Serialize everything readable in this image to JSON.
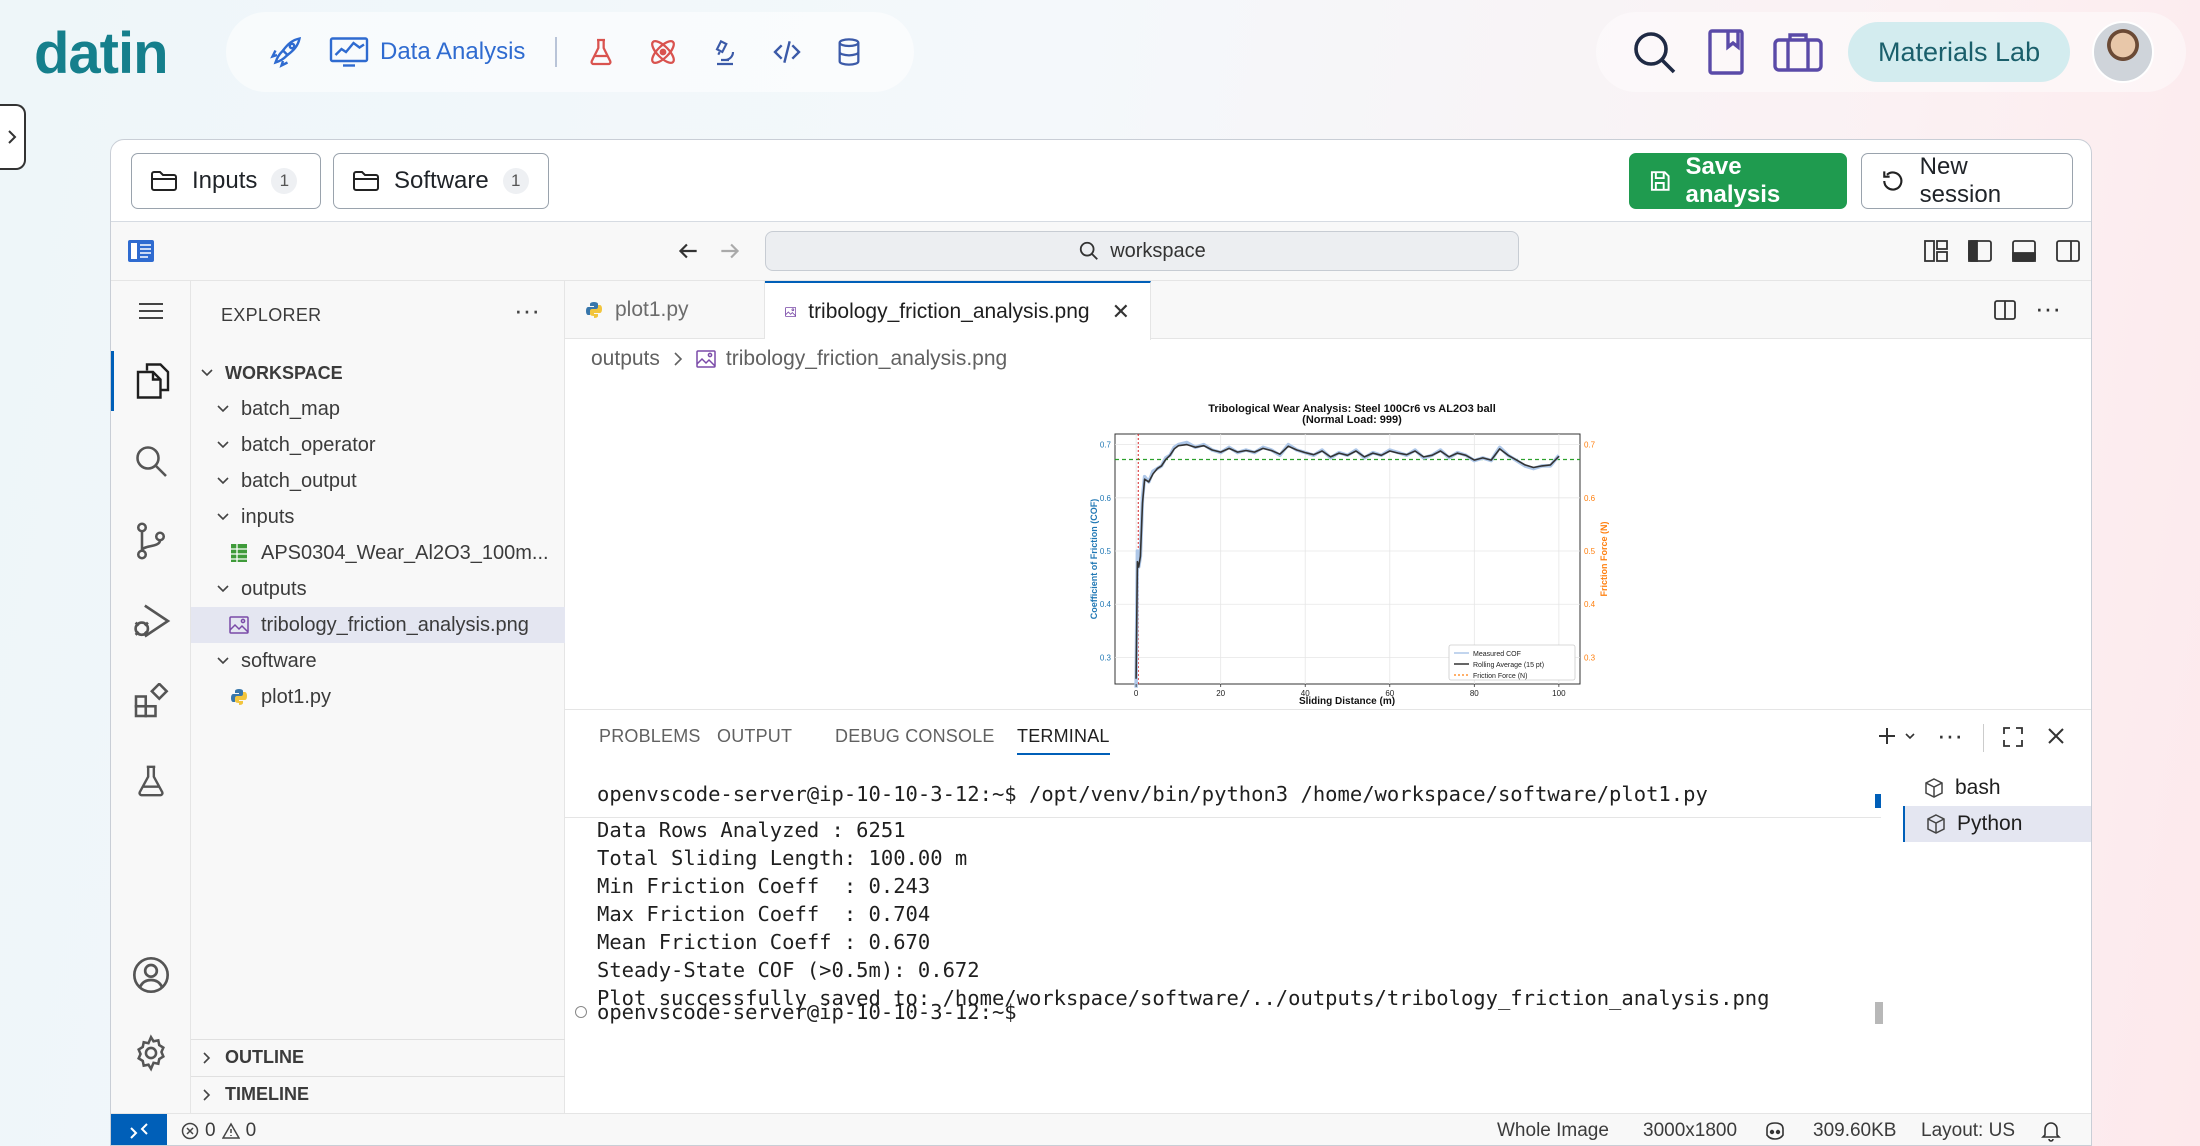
{
  "app": {
    "logo": "datin",
    "nav_active_label": "Data Analysis",
    "lab_label": "Materials Lab"
  },
  "toolbar": {
    "inputs_label": "Inputs",
    "inputs_count": "1",
    "software_label": "Software",
    "software_count": "1",
    "save_label": "Save analysis",
    "new_session_label": "New session"
  },
  "search": {
    "label": "workspace"
  },
  "explorer": {
    "title": "EXPLORER",
    "root": "WORKSPACE",
    "items": [
      {
        "label": "batch_map"
      },
      {
        "label": "batch_operator"
      },
      {
        "label": "batch_output"
      },
      {
        "label": "inputs"
      },
      {
        "label": "APS0304_Wear_Al2O3_100m..."
      },
      {
        "label": "outputs"
      },
      {
        "label": "tribology_friction_analysis.png"
      },
      {
        "label": "software"
      },
      {
        "label": "plot1.py"
      }
    ],
    "outline": "OUTLINE",
    "timeline": "TIMELINE"
  },
  "tabs": [
    {
      "label": "plot1.py"
    },
    {
      "label": "tribology_friction_analysis.png"
    }
  ],
  "breadcrumb": {
    "folder": "outputs",
    "file": "tribology_friction_analysis.png"
  },
  "chart_data": {
    "type": "line",
    "title": "Tribological Wear Analysis: Steel 100Cr6 vs AL2O3 ball",
    "subtitle": "(Normal Load: 999)",
    "xlabel": "Sliding Distance (m)",
    "ylabel": "Coefficient of Friction (COF)",
    "y2label": "Friction Force (N)",
    "xlim": [
      -5,
      105
    ],
    "ylim": [
      0.25,
      0.72
    ],
    "x_ticks": [
      "0",
      "20",
      "40",
      "60",
      "80",
      "100"
    ],
    "y_ticks": [
      "0.3",
      "0.4",
      "0.5",
      "0.6",
      "0.7"
    ],
    "y2_ticks": [
      "0.3",
      "0.4",
      "0.5",
      "0.6",
      "0.7"
    ],
    "grid": true,
    "legend_position": "bottom-right",
    "steady_state_cof": 0.672,
    "steady_state_color": "#2ca02c",
    "run_in_marker_x": 0.5,
    "run_in_color": "#d62728",
    "series": [
      {
        "name": "Measured COF",
        "color": "#aec7e8",
        "x": [
          0,
          0.3,
          0.6,
          1,
          1.5,
          2,
          3,
          4,
          5,
          6,
          7,
          8,
          9,
          10,
          12,
          14,
          16,
          18,
          20,
          22,
          24,
          26,
          28,
          30,
          32,
          34,
          36,
          38,
          40,
          42,
          44,
          46,
          48,
          50,
          52,
          54,
          56,
          58,
          60,
          62,
          64,
          66,
          68,
          70,
          72,
          74,
          76,
          78,
          80,
          82,
          84,
          86,
          88,
          90,
          92,
          94,
          96,
          98,
          100
        ],
        "y": [
          0.243,
          0.5,
          0.47,
          0.49,
          0.6,
          0.64,
          0.63,
          0.65,
          0.655,
          0.66,
          0.675,
          0.68,
          0.695,
          0.7,
          0.704,
          0.695,
          0.7,
          0.69,
          0.685,
          0.695,
          0.685,
          0.69,
          0.685,
          0.695,
          0.69,
          0.68,
          0.7,
          0.69,
          0.685,
          0.68,
          0.69,
          0.675,
          0.685,
          0.68,
          0.69,
          0.675,
          0.685,
          0.68,
          0.69,
          0.685,
          0.68,
          0.69,
          0.675,
          0.68,
          0.69,
          0.675,
          0.685,
          0.68,
          0.67,
          0.675,
          0.67,
          0.695,
          0.68,
          0.67,
          0.66,
          0.655,
          0.66,
          0.66,
          0.68
        ]
      },
      {
        "name": "Rolling Average (15 pt)",
        "color": "#333333",
        "x": [
          0,
          0.3,
          0.6,
          1,
          1.5,
          2,
          3,
          4,
          5,
          6,
          7,
          8,
          9,
          10,
          12,
          14,
          16,
          18,
          20,
          22,
          24,
          26,
          28,
          30,
          32,
          34,
          36,
          38,
          40,
          42,
          44,
          46,
          48,
          50,
          52,
          54,
          56,
          58,
          60,
          62,
          64,
          66,
          68,
          70,
          72,
          74,
          76,
          78,
          80,
          82,
          84,
          86,
          88,
          90,
          92,
          94,
          96,
          98,
          100
        ],
        "y": [
          0.26,
          0.48,
          0.47,
          0.49,
          0.59,
          0.635,
          0.63,
          0.645,
          0.655,
          0.66,
          0.672,
          0.68,
          0.692,
          0.698,
          0.7,
          0.695,
          0.698,
          0.69,
          0.686,
          0.693,
          0.686,
          0.689,
          0.686,
          0.693,
          0.689,
          0.682,
          0.697,
          0.69,
          0.685,
          0.681,
          0.688,
          0.677,
          0.684,
          0.68,
          0.688,
          0.677,
          0.684,
          0.68,
          0.688,
          0.684,
          0.681,
          0.688,
          0.677,
          0.68,
          0.688,
          0.677,
          0.684,
          0.68,
          0.671,
          0.675,
          0.671,
          0.692,
          0.68,
          0.671,
          0.662,
          0.657,
          0.66,
          0.662,
          0.678
        ]
      },
      {
        "name": "Friction Force (N)",
        "color": "#ff7f0e"
      }
    ]
  },
  "panel": {
    "tabs": [
      "PROBLEMS",
      "OUTPUT",
      "DEBUG CONSOLE",
      "TERMINAL"
    ],
    "terminal_lines": [
      "openvscode-server@ip-10-10-3-12:~$ /opt/venv/bin/python3 /home/workspace/software/plot1.py",
      "Data Rows Analyzed : 6251",
      "Total Sliding Length: 100.00 m",
      "Min Friction Coeff  : 0.243",
      "Max Friction Coeff  : 0.704",
      "Mean Friction Coeff : 0.670",
      "Steady-State COF (>0.5m): 0.672",
      "Plot successfully saved to: /home/workspace/software/../outputs/tribology_friction_analysis.png",
      "openvscode-server@ip-10-10-3-12:~$"
    ],
    "terminals": [
      "bash",
      "Python"
    ]
  },
  "status": {
    "errors": "0",
    "warnings": "0",
    "image_mode": "Whole Image",
    "dimensions": "3000x1800",
    "file_size": "309.60KB",
    "layout": "Layout: US"
  }
}
